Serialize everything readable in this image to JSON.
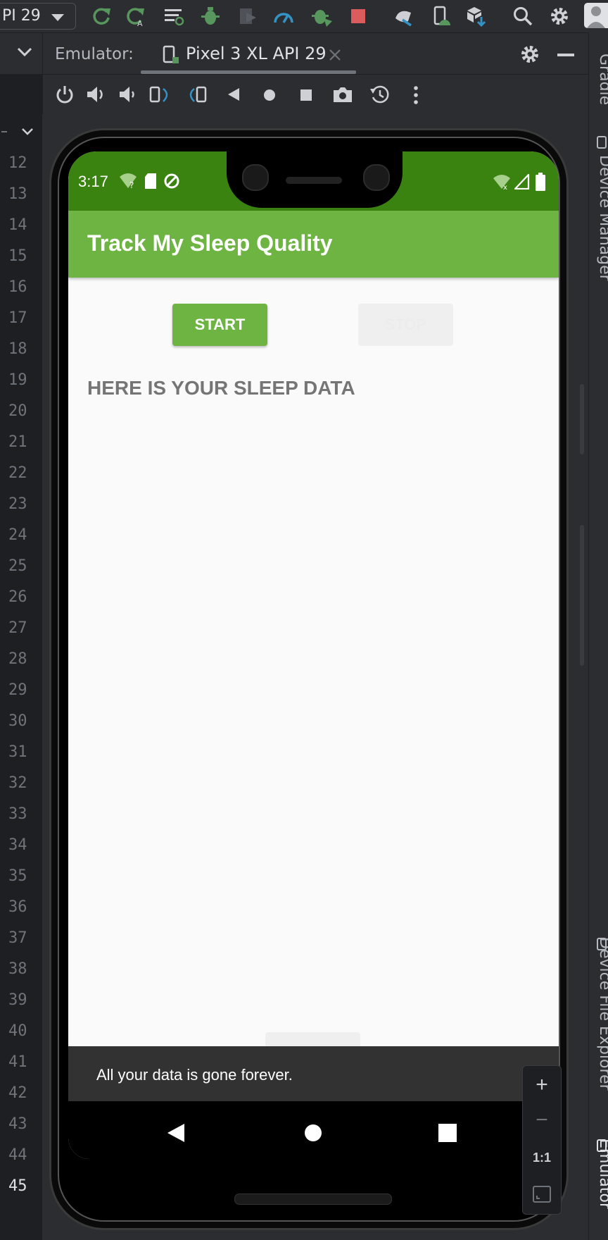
{
  "toolbar": {
    "config_label": "PI 29",
    "icons": [
      "rerun-icon",
      "apply-changes-icon",
      "run-coverage-icon",
      "debug-icon",
      "profile-icon",
      "profiler-gauge-icon",
      "attach-debugger-icon",
      "stop-icon",
      "sync-icon",
      "device-explorer-icon",
      "sdk-manager-icon",
      "search-icon",
      "settings-icon",
      "avatar-icon"
    ]
  },
  "emulator_header": {
    "label": "Emulator:",
    "tab_title": "Pixel 3 XL API 29"
  },
  "gutter": {
    "line_numbers": [
      "12",
      "13",
      "14",
      "15",
      "16",
      "17",
      "18",
      "19",
      "20",
      "21",
      "22",
      "23",
      "24",
      "25",
      "26",
      "27",
      "28",
      "29",
      "30",
      "31",
      "32",
      "33",
      "34",
      "35",
      "36",
      "37",
      "38",
      "39",
      "40",
      "41",
      "42",
      "43",
      "44",
      "45"
    ],
    "current_line": "45"
  },
  "right_stripe": {
    "gradle": "Gradle",
    "device_manager": "Device Manager",
    "device_file_explorer": "Device File Explorer",
    "emulator": "Emulator"
  },
  "phone": {
    "time": "3:17",
    "app_title": "Track My Sleep Quality",
    "start_button": "START",
    "stop_button": "STOP",
    "sleep_header": "HERE IS YOUR SLEEP DATA",
    "snackbar": "All your data is gone forever.",
    "colors": {
      "status_bar": "#3b8311",
      "app_bar": "#6db442"
    }
  },
  "zoom_controls": {
    "zoom_in": "+",
    "zoom_out": "−",
    "actual_size": "1:1"
  }
}
